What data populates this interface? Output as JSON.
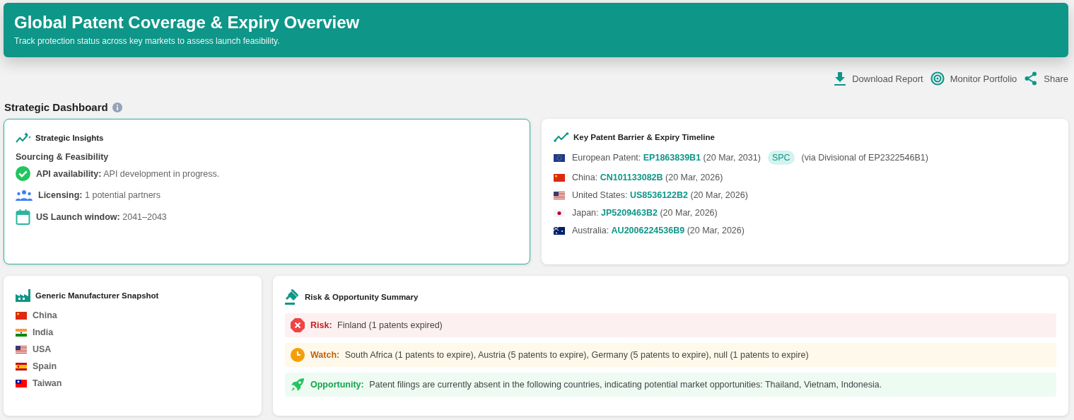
{
  "header": {
    "title": "Global Patent Coverage & Expiry Overview",
    "subtitle": "Track protection status across key markets to assess launch feasibility."
  },
  "actions": [
    {
      "kind": "download",
      "label": "Download Report"
    },
    {
      "kind": "monitor",
      "label": "Monitor Portfolio"
    },
    {
      "kind": "share",
      "label": "Share"
    }
  ],
  "section_title": "Strategic Dashboard",
  "insights": {
    "title": "Strategic Insights",
    "subtitle": "Sourcing & Feasibility",
    "items": [
      {
        "kind": "check",
        "label": "API availability:",
        "value": "API development in progress."
      },
      {
        "kind": "people",
        "label": "Licensing:",
        "value": "1 potential partners"
      },
      {
        "kind": "calendar",
        "label": "US Launch window:",
        "value": "2041–2043"
      }
    ]
  },
  "timeline": {
    "title": "Key Patent Barrier & Expiry Timeline",
    "rows": [
      {
        "kind": "eu",
        "region": "European Patent:",
        "patent": "EP1863839B1",
        "date": "(20 Mar, 2031)",
        "badge": "SPC",
        "note": "(via Divisional of EP2322546B1)"
      },
      {
        "kind": "cn",
        "region": "China:",
        "patent": "CN101133082B",
        "date": "(20 Mar, 2026)"
      },
      {
        "kind": "us",
        "region": "United States:",
        "patent": "US8536122B2",
        "date": "(20 Mar, 2026)"
      },
      {
        "kind": "jp",
        "region": "Japan:",
        "patent": "JP5209463B2",
        "date": "(20 Mar, 2026)"
      },
      {
        "kind": "au",
        "region": "Australia:",
        "patent": "AU2006224536B9",
        "date": "(20 Mar, 2026)"
      }
    ]
  },
  "manufacturers": {
    "title": "Generic Manufacturer Snapshot",
    "items": [
      {
        "kind": "cn",
        "name": "China"
      },
      {
        "kind": "in",
        "name": "India"
      },
      {
        "kind": "us",
        "name": "USA"
      },
      {
        "kind": "es",
        "name": "Spain"
      },
      {
        "kind": "tw",
        "name": "Taiwan"
      }
    ]
  },
  "summary": {
    "title": "Risk & Opportunity Summary",
    "items": [
      {
        "kind": "risk",
        "label": "Risk:",
        "text": "Finland (1 patents expired)"
      },
      {
        "kind": "watch",
        "label": "Watch:",
        "text": "South Africa (1 patents to expire), Austria (5 patents to expire), Germany (5 patents to expire), null (1 patents to expire)"
      },
      {
        "kind": "opportunity",
        "label": "Opportunity:",
        "text": "Patent filings are currently absent in the following countries, indicating potential market opportunities: Thailand, Vietnam, Indonesia."
      }
    ]
  }
}
